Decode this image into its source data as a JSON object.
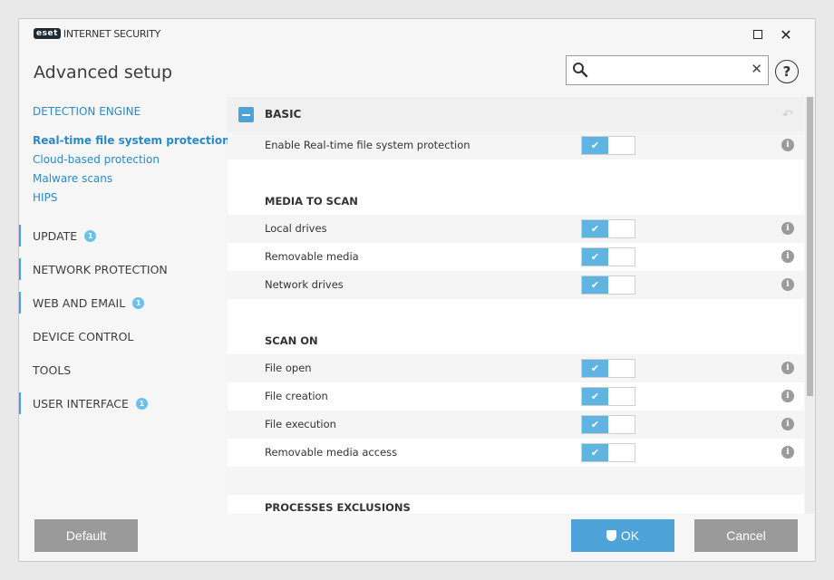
{
  "app": {
    "logo_badge": "eset",
    "logo_text": "INTERNET SECURITY",
    "close_glyph": "✕"
  },
  "page_title": "Advanced setup",
  "search": {
    "value": "",
    "placeholder": "",
    "clear_glyph": "✕",
    "icon": "search-icon"
  },
  "help_label": "?",
  "sidebar": {
    "sections": [
      {
        "label": "DETECTION ENGINE",
        "badge": "",
        "children": [
          "Real-time file system protection",
          "Cloud-based protection",
          "Malware scans",
          "HIPS"
        ],
        "active_child": 0
      },
      {
        "label": "UPDATE",
        "badge": "1"
      },
      {
        "label": "NETWORK PROTECTION",
        "badge": ""
      },
      {
        "label": "WEB AND EMAIL",
        "badge": "1"
      },
      {
        "label": "DEVICE CONTROL",
        "badge": ""
      },
      {
        "label": "TOOLS",
        "badge": ""
      },
      {
        "label": "USER INTERFACE",
        "badge": "1"
      }
    ]
  },
  "content": {
    "basic_title": "BASIC",
    "basic_rows": [
      {
        "label": "Enable Real-time file system protection",
        "enabled": true
      }
    ],
    "media_title": "MEDIA TO SCAN",
    "media_rows": [
      {
        "label": "Local drives",
        "enabled": true
      },
      {
        "label": "Removable media",
        "enabled": true
      },
      {
        "label": "Network drives",
        "enabled": true
      }
    ],
    "scan_on_title": "SCAN ON",
    "scan_on_rows": [
      {
        "label": "File open",
        "enabled": true
      },
      {
        "label": "File creation",
        "enabled": true
      },
      {
        "label": "File execution",
        "enabled": true
      },
      {
        "label": "Removable media access",
        "enabled": true
      }
    ],
    "processes_title": "PROCESSES EXCLUSIONS",
    "check_glyph": "✔",
    "info_glyph": "i",
    "revert_glyph": "↶"
  },
  "buttons": {
    "default": "Default",
    "ok": "OK",
    "cancel": "Cancel"
  },
  "colors": {
    "accent": "#4da3d8",
    "toggle_on": "#5fb4e2",
    "button_gray": "#9a9a9a"
  }
}
